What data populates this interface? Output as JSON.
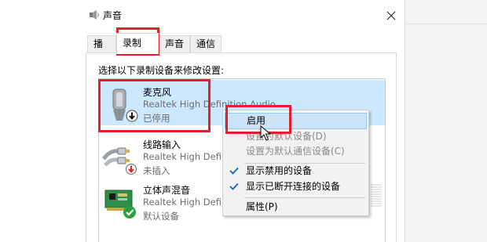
{
  "window": {
    "title": "声音",
    "close_icon": "close-icon"
  },
  "tabs": [
    {
      "label": "播放",
      "active": false
    },
    {
      "label": "录制",
      "active": true
    },
    {
      "label": "声音",
      "active": false
    },
    {
      "label": "通信",
      "active": false
    }
  ],
  "instruction": "选择以下录制设备来修改设置:",
  "devices": [
    {
      "name": "麦克风",
      "driver": "Realtek High Definition Audio",
      "status": "已停用",
      "icon": "microphone-icon",
      "badge": "down-arrow-badge",
      "selected": true
    },
    {
      "name": "线路输入",
      "driver": "Realtek High Definition Audio",
      "status": "未插入",
      "icon": "line-in-cable-icon",
      "badge": "red-down-arrow-badge",
      "selected": false
    },
    {
      "name": "立体声混音",
      "driver": "Realtek High Definition Audio",
      "status": "默认设备",
      "icon": "sound-card-icon",
      "badge": "green-check-badge",
      "selected": false
    }
  ],
  "context_menu": {
    "items": [
      {
        "label": "启用",
        "state": "highlighted"
      },
      {
        "label": "设置为默认设备(D)",
        "state": "disabled"
      },
      {
        "label": "设置为默认通信设备(C)",
        "state": "disabled"
      },
      {
        "label": "显示禁用的设备",
        "state": "checked"
      },
      {
        "label": "显示已断开连接的设备",
        "state": "checked"
      },
      {
        "label": "属性(P)",
        "state": "normal"
      }
    ]
  },
  "colors": {
    "highlight_box": "#e4202b",
    "selection": "#cce8ff",
    "check": "#0a64c8"
  }
}
